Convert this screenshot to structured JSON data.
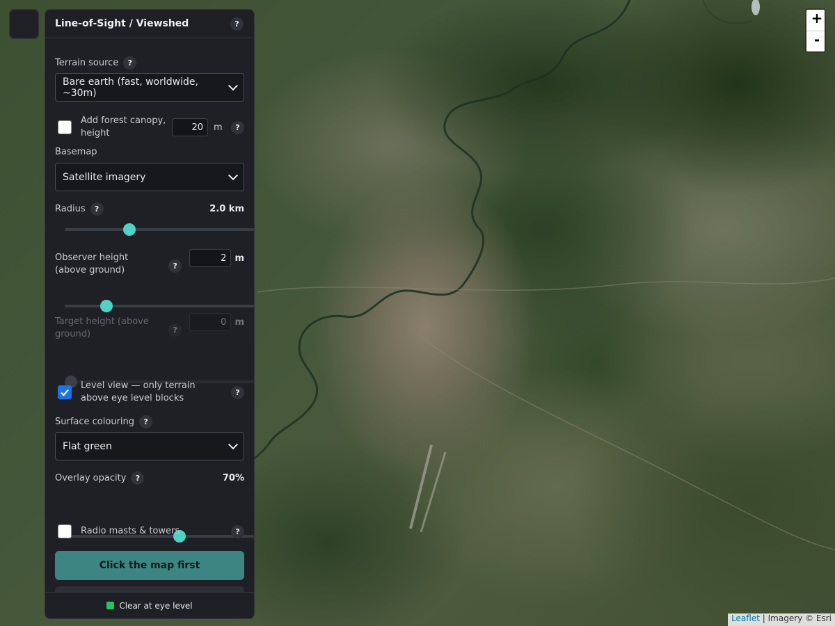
{
  "panel": {
    "title": "Line-of-Sight / Viewshed",
    "terrain_source": {
      "label": "Terrain source",
      "selected": "Bare earth (fast, worldwide, ~30m)"
    },
    "forest": {
      "label": "Add forest canopy, height",
      "checked": false,
      "value": "20",
      "unit": "m"
    },
    "basemap": {
      "label": "Basemap",
      "selected": "Satellite imagery"
    },
    "radius": {
      "label": "Radius",
      "value": "2.0 km",
      "fraction": 0.33
    },
    "observer": {
      "label": "Observer height (above ground)",
      "value": "2",
      "unit": "m",
      "fraction": 0.2
    },
    "target": {
      "label": "Target height (above ground)",
      "value": "0",
      "unit": "m",
      "fraction": 0.0,
      "disabled": true
    },
    "level_view": {
      "label": "Level view — only terrain above eye level blocks",
      "checked": true
    },
    "surface_colouring": {
      "label": "Surface colouring",
      "selected": "Flat green"
    },
    "opacity": {
      "label": "Overlay opacity",
      "value": "70%",
      "fraction": 0.615
    },
    "masts": {
      "label": "Radio masts & towers",
      "checked": false
    },
    "primary_button": "Click the map first",
    "legend": {
      "label": "Clear at eye level",
      "color": "#22c55e"
    },
    "help_glyph": "?"
  },
  "zoom": {
    "in": "+",
    "out": "-"
  },
  "attribution": {
    "link": "Leaflet",
    "separator": "|",
    "text": "Imagery © Esri"
  },
  "colors": {
    "accent": "#4fd1c5",
    "button": "#3d8582",
    "panel_bg": "#1e2026",
    "checkbox_checked": "#1a73e8"
  }
}
